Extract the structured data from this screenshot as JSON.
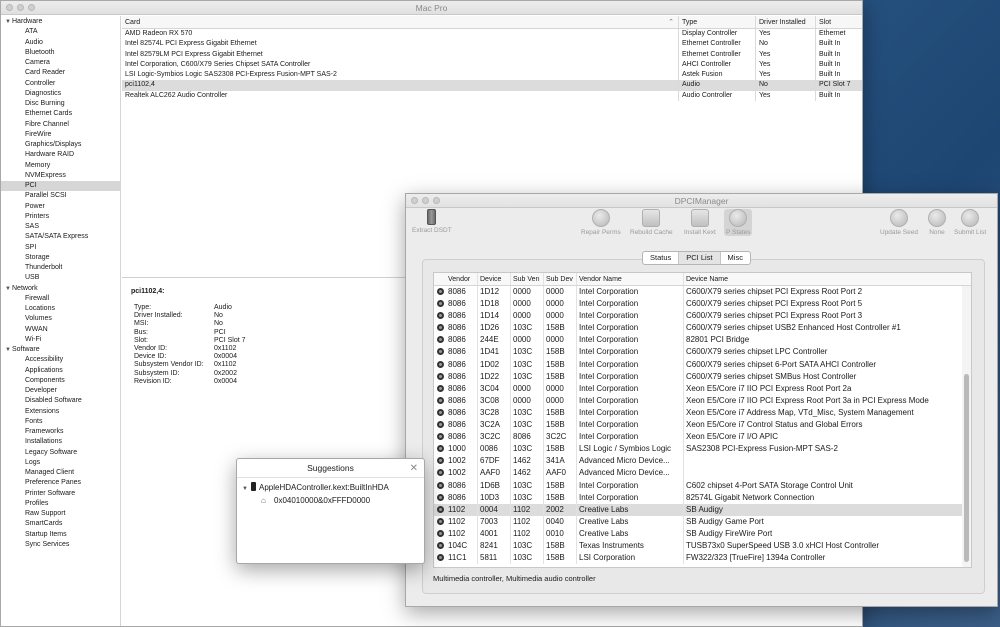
{
  "sysinfo": {
    "title": "Mac Pro",
    "sidebar": [
      {
        "label": "Hardware",
        "kind": "head"
      },
      {
        "label": "ATA"
      },
      {
        "label": "Audio"
      },
      {
        "label": "Bluetooth"
      },
      {
        "label": "Camera"
      },
      {
        "label": "Card Reader"
      },
      {
        "label": "Controller"
      },
      {
        "label": "Diagnostics"
      },
      {
        "label": "Disc Burning"
      },
      {
        "label": "Ethernet Cards"
      },
      {
        "label": "Fibre Channel"
      },
      {
        "label": "FireWire"
      },
      {
        "label": "Graphics/Displays"
      },
      {
        "label": "Hardware RAID"
      },
      {
        "label": "Memory"
      },
      {
        "label": "NVMExpress"
      },
      {
        "label": "PCI",
        "selected": true
      },
      {
        "label": "Parallel SCSI"
      },
      {
        "label": "Power"
      },
      {
        "label": "Printers"
      },
      {
        "label": "SAS"
      },
      {
        "label": "SATA/SATA Express"
      },
      {
        "label": "SPI"
      },
      {
        "label": "Storage"
      },
      {
        "label": "Thunderbolt"
      },
      {
        "label": "USB"
      },
      {
        "label": "Network",
        "kind": "head"
      },
      {
        "label": "Firewall"
      },
      {
        "label": "Locations"
      },
      {
        "label": "Volumes"
      },
      {
        "label": "WWAN"
      },
      {
        "label": "Wi-Fi"
      },
      {
        "label": "Software",
        "kind": "head"
      },
      {
        "label": "Accessibility"
      },
      {
        "label": "Applications"
      },
      {
        "label": "Components"
      },
      {
        "label": "Developer"
      },
      {
        "label": "Disabled Software"
      },
      {
        "label": "Extensions"
      },
      {
        "label": "Fonts"
      },
      {
        "label": "Frameworks"
      },
      {
        "label": "Installations"
      },
      {
        "label": "Legacy Software"
      },
      {
        "label": "Logs"
      },
      {
        "label": "Managed Client"
      },
      {
        "label": "Preference Panes"
      },
      {
        "label": "Printer Software"
      },
      {
        "label": "Profiles"
      },
      {
        "label": "Raw Support"
      },
      {
        "label": "SmartCards"
      },
      {
        "label": "Startup Items"
      },
      {
        "label": "Sync Services"
      }
    ],
    "table": {
      "headers": {
        "card": "Card",
        "type": "Type",
        "driver": "Driver Installed",
        "slot": "Slot"
      },
      "rows": [
        {
          "card": "AMD Radeon RX 570",
          "type": "Display Controller",
          "driver": "Yes",
          "slot": "Ethernet"
        },
        {
          "card": "Intel 82574L PCI Express Gigabit Ethernet",
          "type": "Ethernet Controller",
          "driver": "No",
          "slot": "Built In"
        },
        {
          "card": "Intel 82579LM PCI Express Gigabit Ethernet",
          "type": "Ethernet Controller",
          "driver": "Yes",
          "slot": "Built In"
        },
        {
          "card": "Intel Corporation, C600/X79 Series Chipset SATA Controller",
          "type": "AHCI Controller",
          "driver": "Yes",
          "slot": "Built In"
        },
        {
          "card": "LSI Logic-Symbios Logic SAS2308 PCI-Express Fusion-MPT SAS-2",
          "type": "Astek Fusion",
          "driver": "Yes",
          "slot": "Built In"
        },
        {
          "card": "pci1102,4",
          "type": "Audio",
          "driver": "No",
          "slot": "PCI Slot 7",
          "selected": true
        },
        {
          "card": "Realtek ALC262 Audio Controller",
          "type": "Audio Controller",
          "driver": "Yes",
          "slot": "Built In"
        }
      ]
    },
    "detail": {
      "title": "pci1102,4:",
      "fields": [
        {
          "k": "Type:",
          "v": "Audio"
        },
        {
          "k": "Driver Installed:",
          "v": "No"
        },
        {
          "k": "MSI:",
          "v": "No"
        },
        {
          "k": "Bus:",
          "v": "PCI"
        },
        {
          "k": "Slot:",
          "v": "PCI Slot 7"
        },
        {
          "k": "Vendor ID:",
          "v": "0x1102"
        },
        {
          "k": "Device ID:",
          "v": "0x0004"
        },
        {
          "k": "Subsystem Vendor ID:",
          "v": "0x1102"
        },
        {
          "k": "Subsystem ID:",
          "v": "0x2002"
        },
        {
          "k": "Revision ID:",
          "v": "0x0004"
        }
      ]
    }
  },
  "dpci": {
    "title": "DPCIManager",
    "toolbar": {
      "extract": "Extract DSDT",
      "repair": "Repair Perms",
      "rebuild": "Rebuild Cache",
      "install": "Install Kext",
      "pstates": "P States",
      "update": "Update Seed",
      "none": "None",
      "submit": "Submit List"
    },
    "tabs": [
      "Status",
      "PCI List",
      "Misc"
    ],
    "active_tab": "PCI List",
    "headers": {
      "vendor": "Vendor",
      "device": "Device",
      "subven": "Sub Ven",
      "subdev": "Sub Dev",
      "vname": "Vendor Name",
      "dname": "Device Name"
    },
    "rows": [
      {
        "v": "8086",
        "d": "1D12",
        "sv": "0000",
        "sd": "0000",
        "vn": "Intel Corporation",
        "dn": "C600/X79 series chipset PCI Express Root Port 2"
      },
      {
        "v": "8086",
        "d": "1D18",
        "sv": "0000",
        "sd": "0000",
        "vn": "Intel Corporation",
        "dn": "C600/X79 series chipset PCI Express Root Port 5"
      },
      {
        "v": "8086",
        "d": "1D14",
        "sv": "0000",
        "sd": "0000",
        "vn": "Intel Corporation",
        "dn": "C600/X79 series chipset PCI Express Root Port 3"
      },
      {
        "v": "8086",
        "d": "1D26",
        "sv": "103C",
        "sd": "158B",
        "vn": "Intel Corporation",
        "dn": "C600/X79 series chipset USB2 Enhanced Host Controller #1"
      },
      {
        "v": "8086",
        "d": "244E",
        "sv": "0000",
        "sd": "0000",
        "vn": "Intel Corporation",
        "dn": "82801 PCI Bridge"
      },
      {
        "v": "8086",
        "d": "1D41",
        "sv": "103C",
        "sd": "158B",
        "vn": "Intel Corporation",
        "dn": "C600/X79 series chipset LPC Controller"
      },
      {
        "v": "8086",
        "d": "1D02",
        "sv": "103C",
        "sd": "158B",
        "vn": "Intel Corporation",
        "dn": "C600/X79 series chipset 6-Port SATA AHCI Controller"
      },
      {
        "v": "8086",
        "d": "1D22",
        "sv": "103C",
        "sd": "158B",
        "vn": "Intel Corporation",
        "dn": "C600/X79 series chipset SMBus Host Controller"
      },
      {
        "v": "8086",
        "d": "3C04",
        "sv": "0000",
        "sd": "0000",
        "vn": "Intel Corporation",
        "dn": "Xeon E5/Core i7 IIO PCI Express Root Port 2a"
      },
      {
        "v": "8086",
        "d": "3C08",
        "sv": "0000",
        "sd": "0000",
        "vn": "Intel Corporation",
        "dn": "Xeon E5/Core i7 IIO PCI Express Root Port 3a in PCI Express Mode"
      },
      {
        "v": "8086",
        "d": "3C28",
        "sv": "103C",
        "sd": "158B",
        "vn": "Intel Corporation",
        "dn": "Xeon E5/Core i7 Address Map, VTd_Misc, System Management"
      },
      {
        "v": "8086",
        "d": "3C2A",
        "sv": "103C",
        "sd": "158B",
        "vn": "Intel Corporation",
        "dn": "Xeon E5/Core i7 Control Status and Global Errors"
      },
      {
        "v": "8086",
        "d": "3C2C",
        "sv": "8086",
        "sd": "3C2C",
        "vn": "Intel Corporation",
        "dn": "Xeon E5/Core i7 I/O APIC"
      },
      {
        "v": "1000",
        "d": "0086",
        "sv": "103C",
        "sd": "158B",
        "vn": "LSI Logic / Symbios Logic",
        "dn": "SAS2308 PCI-Express Fusion-MPT SAS-2"
      },
      {
        "v": "1002",
        "d": "67DF",
        "sv": "1462",
        "sd": "341A",
        "vn": "Advanced Micro Device...",
        "dn": ""
      },
      {
        "v": "1002",
        "d": "AAF0",
        "sv": "1462",
        "sd": "AAF0",
        "vn": "Advanced Micro Device...",
        "dn": ""
      },
      {
        "v": "8086",
        "d": "1D6B",
        "sv": "103C",
        "sd": "158B",
        "vn": "Intel Corporation",
        "dn": "C602 chipset 4-Port SATA Storage Control Unit"
      },
      {
        "v": "8086",
        "d": "10D3",
        "sv": "103C",
        "sd": "158B",
        "vn": "Intel Corporation",
        "dn": "82574L Gigabit Network Connection"
      },
      {
        "v": "1102",
        "d": "0004",
        "sv": "1102",
        "sd": "2002",
        "vn": "Creative Labs",
        "dn": "SB Audigy",
        "selected": true
      },
      {
        "v": "1102",
        "d": "7003",
        "sv": "1102",
        "sd": "0040",
        "vn": "Creative Labs",
        "dn": "SB Audigy Game Port"
      },
      {
        "v": "1102",
        "d": "4001",
        "sv": "1102",
        "sd": "0010",
        "vn": "Creative Labs",
        "dn": "SB Audigy FireWire Port"
      },
      {
        "v": "104C",
        "d": "8241",
        "sv": "103C",
        "sd": "158B",
        "vn": "Texas Instruments",
        "dn": "TUSB73x0 SuperSpeed USB 3.0 xHCI Host Controller"
      },
      {
        "v": "11C1",
        "d": "5811",
        "sv": "103C",
        "sd": "158B",
        "vn": "LSI Corporation",
        "dn": "FW322/323 [TrueFire] 1394a Controller"
      }
    ],
    "status_text": "Multimedia controller, Multimedia audio controller"
  },
  "suggestions": {
    "title": "Suggestions",
    "close_glyph": "✕",
    "kext": "AppleHDAController.kext:BuiltInHDA",
    "value": "0x04010000&0xFFFD0000"
  }
}
